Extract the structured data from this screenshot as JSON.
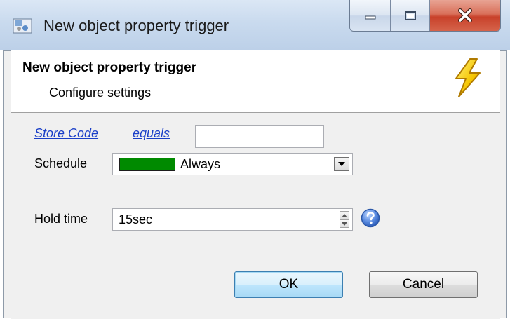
{
  "window": {
    "title": "New object property trigger",
    "icon": "window-app-icon",
    "caption_buttons": [
      "minimize-icon",
      "maximize-icon",
      "close-icon"
    ]
  },
  "header": {
    "title": "New object property trigger",
    "subtitle": "Configure settings",
    "icon": "lightning-bolt-icon"
  },
  "condition": {
    "field_link": "Store Code",
    "operator_link": "equals",
    "value": ""
  },
  "schedule": {
    "label": "Schedule",
    "selected": "Always",
    "swatch_color": "#008a00"
  },
  "hold_time": {
    "label": "Hold time",
    "value": "15sec"
  },
  "buttons": {
    "ok": "OK",
    "cancel": "Cancel"
  },
  "colors": {
    "link": "#1a3fc8",
    "ok_button_border": "#3c7fb1",
    "help_icon": "#3b6fd0"
  }
}
